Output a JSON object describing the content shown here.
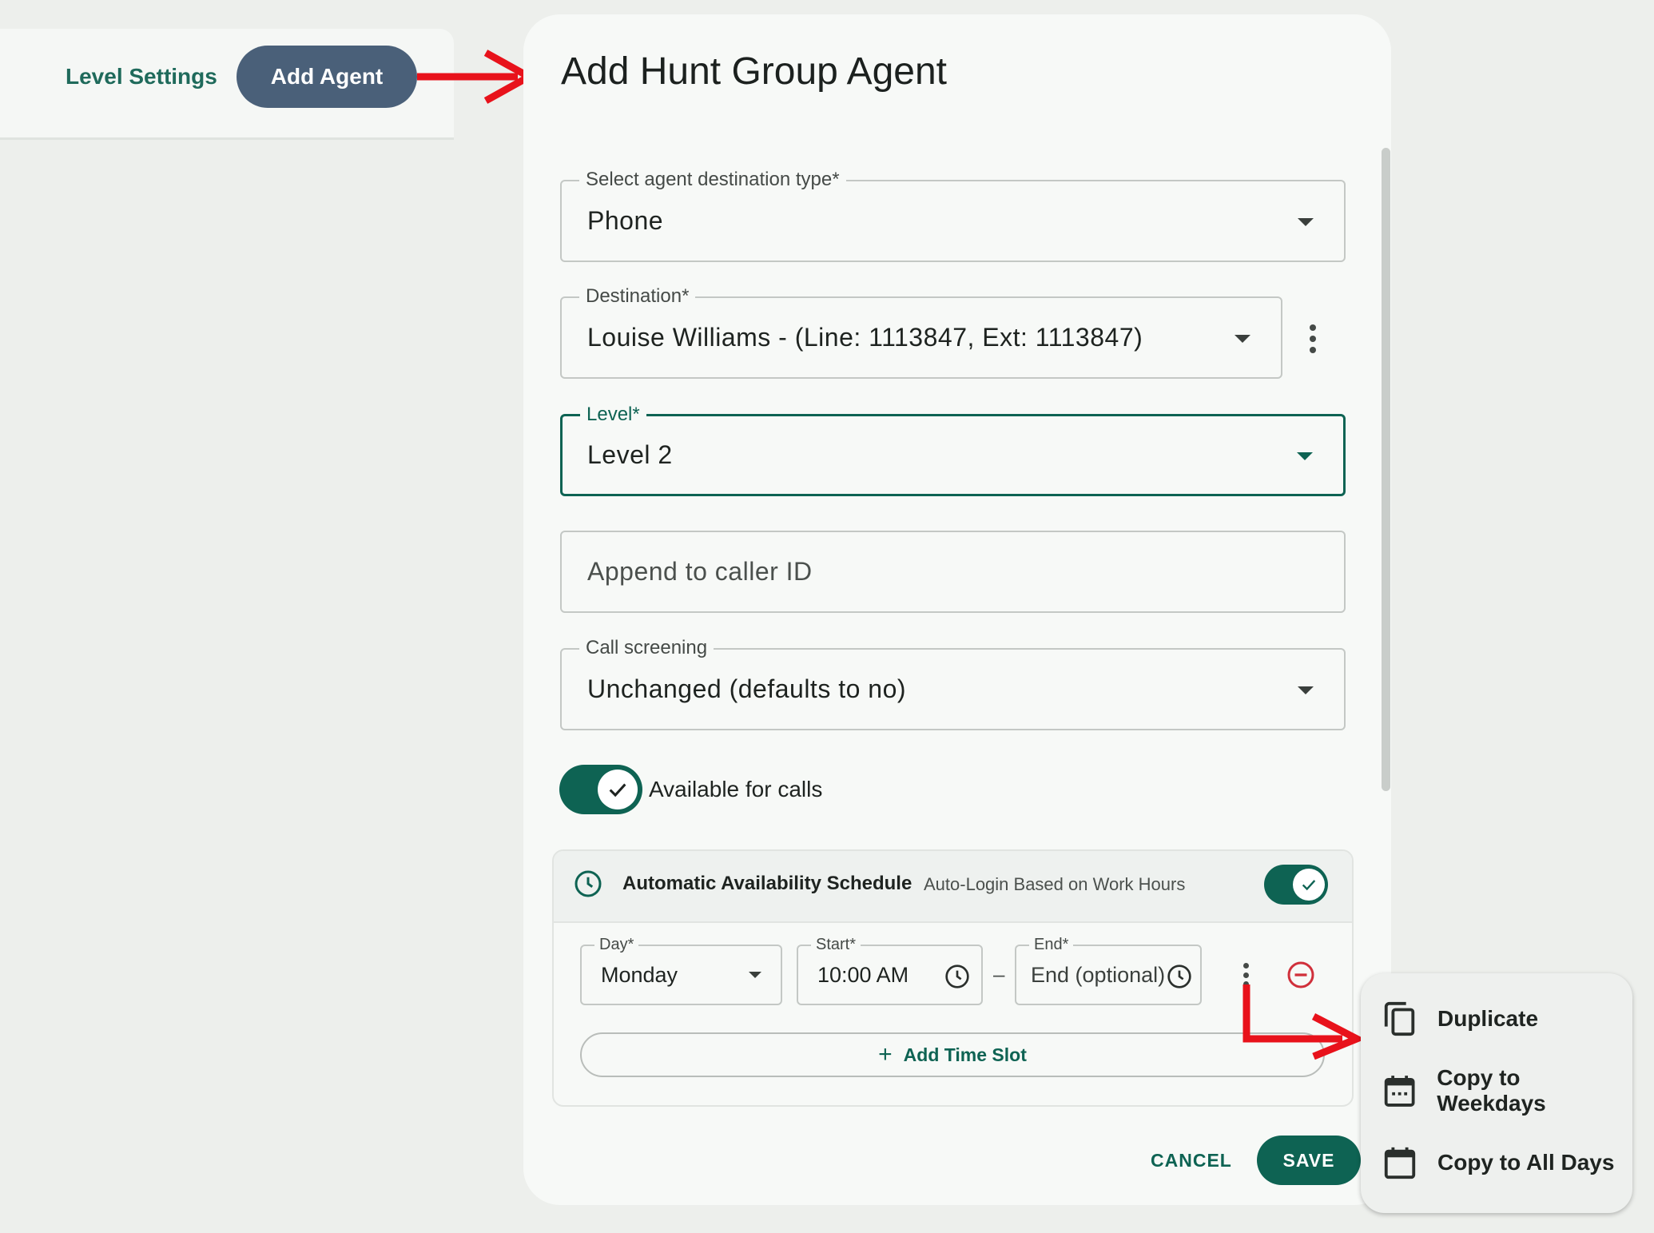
{
  "tabs": {
    "level_settings": "Level Settings",
    "add_agent": "Add Agent"
  },
  "dialog": {
    "title": "Add Hunt Group Agent",
    "destination_type": {
      "label": "Select agent destination type*",
      "value": "Phone"
    },
    "destination": {
      "label": "Destination*",
      "value": "Louise Williams - (Line: 1113847, Ext: 1113847)"
    },
    "level": {
      "label": "Level*",
      "value": "Level 2"
    },
    "append_caller_id": {
      "placeholder": "Append to caller ID"
    },
    "call_screening": {
      "label": "Call screening",
      "value": "Unchanged (defaults to no)"
    },
    "available_for_calls": {
      "label": "Available for calls",
      "on": true
    },
    "schedule": {
      "title": "Automatic Availability Schedule",
      "subtitle": "Auto-Login Based on Work Hours",
      "on": true,
      "slot": {
        "day": {
          "label": "Day*",
          "value": "Monday"
        },
        "start": {
          "label": "Start*",
          "value": "10:00 AM"
        },
        "separator": "–",
        "end": {
          "label": "End*",
          "placeholder": "End (optional)"
        }
      },
      "add_time_slot": "Add Time Slot"
    },
    "cancel": "CANCEL",
    "save": "SAVE"
  },
  "context_menu": {
    "items": [
      {
        "label": "Duplicate",
        "icon": "copy-icon"
      },
      {
        "label": "Copy to Weekdays",
        "icon": "calendar-dots-icon"
      },
      {
        "label": "Copy to All Days",
        "icon": "calendar-icon"
      }
    ]
  },
  "colors": {
    "accent": "#0e6353",
    "tab_active": "#4a6079",
    "annotation_arrow": "#e8121b",
    "remove": "#d0303b"
  }
}
